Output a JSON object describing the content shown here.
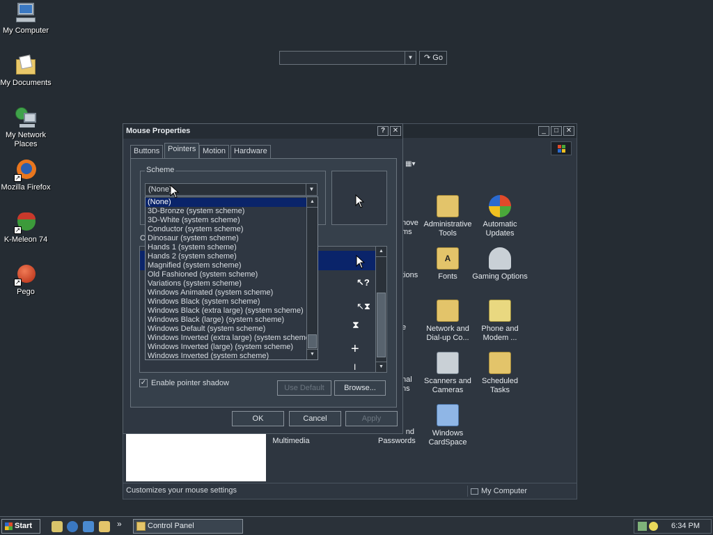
{
  "desktop": {
    "icons": [
      {
        "label": "My Computer"
      },
      {
        "label": "My Documents"
      },
      {
        "label": "My Network Places"
      },
      {
        "label": "Mozilla Firefox"
      },
      {
        "label": "K-Meleon 74"
      },
      {
        "label": "Pego"
      }
    ]
  },
  "control_panel": {
    "go_label": "Go",
    "icons": [
      {
        "label": "Administrative Tools"
      },
      {
        "label": "Automatic Updates"
      },
      {
        "label": "Fonts"
      },
      {
        "label": "Gaming Options"
      },
      {
        "label": "Network and Dial-up Co..."
      },
      {
        "label": "Phone and Modem ..."
      },
      {
        "label": "Scanners and Cameras"
      },
      {
        "label": "Scheduled Tasks"
      },
      {
        "label": "Windows CardSpace"
      },
      {
        "label": "Multimedia"
      }
    ],
    "partial_labels": [
      "nove",
      "ms",
      "tions",
      "e",
      "nal",
      "ns",
      "nd",
      "Passwords"
    ],
    "status_text": "Customizes your mouse settings",
    "status_location": "My Computer"
  },
  "dialog": {
    "title": "Mouse Properties",
    "help_btn": "?",
    "close_btn": "✕",
    "tabs": [
      "Buttons",
      "Pointers",
      "Motion",
      "Hardware"
    ],
    "scheme_label": "Scheme",
    "scheme_value": "(None)",
    "customize_label": "C",
    "scheme_options": [
      "(None)",
      "3D-Bronze (system scheme)",
      "3D-White (system scheme)",
      "Conductor (system scheme)",
      "Dinosaur (system scheme)",
      "Hands 1 (system scheme)",
      "Hands 2 (system scheme)",
      "Magnified (system scheme)",
      "Old Fashioned (system scheme)",
      "Variations (system scheme)",
      "Windows Animated (system scheme)",
      "Windows Black  (system scheme)",
      "Windows Black (extra large) (system scheme)",
      "Windows Black (large) (system scheme)",
      "Windows Default (system scheme)",
      "Windows Inverted (extra large) (system scheme)",
      "Windows Inverted (large) (system scheme)",
      "Windows Inverted (system scheme)"
    ],
    "enable_shadow_label": "Enable pointer shadow",
    "enable_shadow_checked": true,
    "use_default_label": "Use Default",
    "browse_label": "Browse...",
    "ok_label": "OK",
    "cancel_label": "Cancel",
    "apply_label": "Apply"
  },
  "taskbar": {
    "start_label": "Start",
    "task_label": "Control Panel",
    "clock": "6:34 PM",
    "more_label": "»"
  }
}
